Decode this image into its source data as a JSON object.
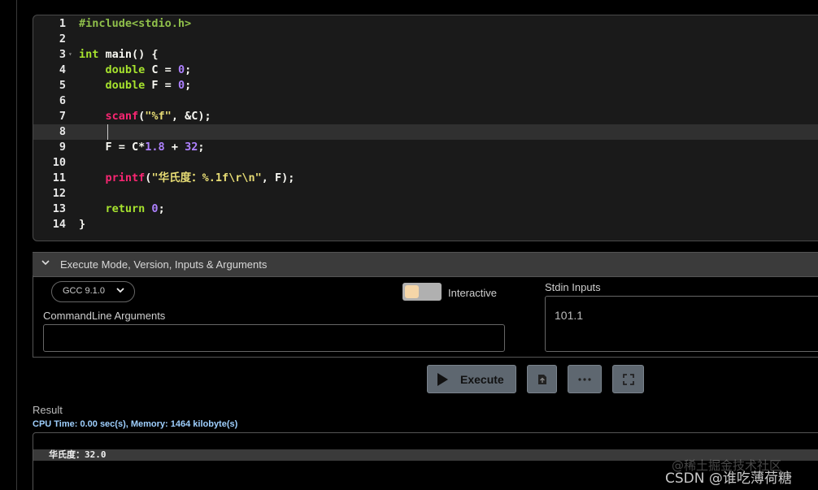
{
  "editor": {
    "lines": [
      {
        "n": "1",
        "segs": [
          {
            "t": "#include<stdio.h>",
            "c": "k-inc"
          }
        ]
      },
      {
        "n": "2",
        "segs": []
      },
      {
        "n": "3",
        "fold": true,
        "segs": [
          {
            "t": "int ",
            "c": "k-green"
          },
          {
            "t": "main() {",
            "c": "k-white"
          }
        ]
      },
      {
        "n": "4",
        "segs": [
          {
            "t": "    ",
            "c": "k-white"
          },
          {
            "t": "double ",
            "c": "k-green"
          },
          {
            "t": "C = ",
            "c": "k-white"
          },
          {
            "t": "0",
            "c": "k-purple"
          },
          {
            "t": ";",
            "c": "k-white"
          }
        ]
      },
      {
        "n": "5",
        "segs": [
          {
            "t": "    ",
            "c": "k-white"
          },
          {
            "t": "double ",
            "c": "k-green"
          },
          {
            "t": "F = ",
            "c": "k-white"
          },
          {
            "t": "0",
            "c": "k-purple"
          },
          {
            "t": ";",
            "c": "k-white"
          }
        ]
      },
      {
        "n": "6",
        "segs": []
      },
      {
        "n": "7",
        "segs": [
          {
            "t": "    ",
            "c": "k-white"
          },
          {
            "t": "scanf",
            "c": "k-red"
          },
          {
            "t": "(",
            "c": "k-white"
          },
          {
            "t": "\"%f\"",
            "c": "k-yellow"
          },
          {
            "t": ", &C);",
            "c": "k-white"
          }
        ]
      },
      {
        "n": "8",
        "active": true,
        "segs": []
      },
      {
        "n": "9",
        "segs": [
          {
            "t": "    ",
            "c": "k-white"
          },
          {
            "t": "F = C*",
            "c": "k-white"
          },
          {
            "t": "1.8",
            "c": "k-purple"
          },
          {
            "t": " + ",
            "c": "k-white"
          },
          {
            "t": "32",
            "c": "k-purple"
          },
          {
            "t": ";",
            "c": "k-white"
          }
        ]
      },
      {
        "n": "10",
        "segs": []
      },
      {
        "n": "11",
        "segs": [
          {
            "t": "    ",
            "c": "k-white"
          },
          {
            "t": "printf",
            "c": "k-red"
          },
          {
            "t": "(",
            "c": "k-white"
          },
          {
            "t": "\"华氏度：%.1f\\r\\n\"",
            "c": "k-yellow"
          },
          {
            "t": ", F);",
            "c": "k-white"
          }
        ]
      },
      {
        "n": "12",
        "segs": []
      },
      {
        "n": "13",
        "segs": [
          {
            "t": "    ",
            "c": "k-white"
          },
          {
            "t": "return ",
            "c": "k-green"
          },
          {
            "t": "0",
            "c": "k-purple"
          },
          {
            "t": ";",
            "c": "k-white"
          }
        ]
      },
      {
        "n": "14",
        "segs": [
          {
            "t": "}",
            "c": "k-white"
          }
        ]
      }
    ]
  },
  "exec": {
    "header_title": "Execute Mode, Version, Inputs & Arguments",
    "compiler": "GCC 9.1.0",
    "interactive_label": "Interactive",
    "cmd_label": "CommandLine Arguments",
    "cmd_value": "",
    "stdin_label": "Stdin Inputs",
    "stdin_value": "101.1",
    "execute_label": "Execute"
  },
  "result": {
    "label": "Result",
    "stats": "CPU Time: 0.00 sec(s), Memory: 1464 kilobyte(s)",
    "output": "华氏度：32.0"
  },
  "watermark": {
    "line1": "@稀土掘金技术社区",
    "line2": "CSDN @谁吃薄荷糖"
  },
  "icons": [
    "chevron-down-icon",
    "play-icon",
    "upload-icon",
    "more-icon",
    "fullscreen-icon"
  ]
}
